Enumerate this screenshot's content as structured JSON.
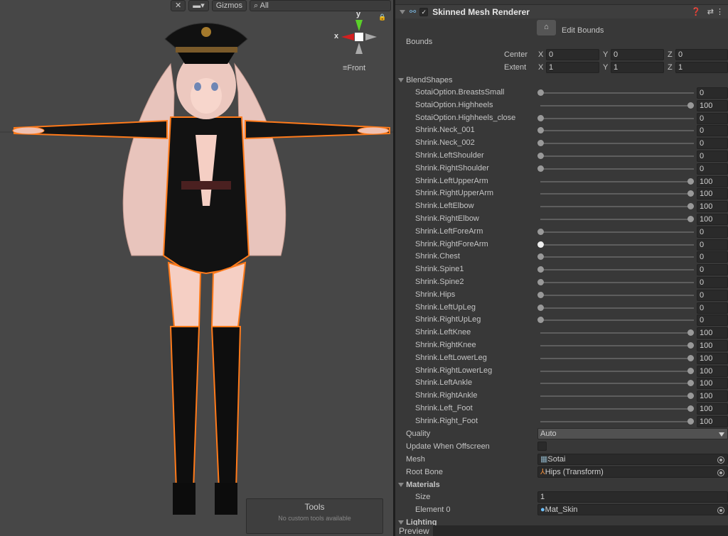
{
  "scene": {
    "toolbar": {
      "gizmos_label": "Gizmos",
      "search_placeholder": "All"
    },
    "gizmo": {
      "y_label": "y",
      "x_label": "x",
      "view_label": "Front"
    },
    "tools_panel": {
      "title": "Tools",
      "message": "No custom tools available"
    },
    "colors": {
      "outline": "#ff7a1a",
      "background": "#474747"
    }
  },
  "inspector": {
    "component_title": "Skinned Mesh Renderer",
    "enabled": true,
    "edit_bounds_label": "Edit Bounds",
    "bounds": {
      "label": "Bounds",
      "center": {
        "label": "Center",
        "x": "0",
        "y": "0",
        "z": "0"
      },
      "extent": {
        "label": "Extent",
        "x": "1",
        "y": "1",
        "z": "1"
      },
      "axis_x": "X",
      "axis_y": "Y",
      "axis_z": "Z"
    },
    "blendshapes_label": "BlendShapes",
    "blendshapes": [
      {
        "name": "SotaiOption.BreastsSmall",
        "value": 0
      },
      {
        "name": "SotaiOption.Highheels",
        "value": 100
      },
      {
        "name": "SotaiOption.Highheels_close",
        "value": 0
      },
      {
        "name": "Shrink.Neck_001",
        "value": 0
      },
      {
        "name": "Shrink.Neck_002",
        "value": 0
      },
      {
        "name": "Shrink.LeftShoulder",
        "value": 0
      },
      {
        "name": "Shrink.RightShoulder",
        "value": 0
      },
      {
        "name": "Shrink.LeftUpperArm",
        "value": 100
      },
      {
        "name": "Shrink.RightUpperArm",
        "value": 100
      },
      {
        "name": "Shrink.LeftElbow",
        "value": 100
      },
      {
        "name": "Shrink.RightElbow",
        "value": 100
      },
      {
        "name": "Shrink.LeftForeArm",
        "value": 0
      },
      {
        "name": "Shrink.RightForeArm",
        "value": 0
      },
      {
        "name": "Shrink.Chest",
        "value": 0
      },
      {
        "name": "Shrink.Spine1",
        "value": 0
      },
      {
        "name": "Shrink.Spine2",
        "value": 0
      },
      {
        "name": "Shrink.Hips",
        "value": 0
      },
      {
        "name": "Shrink.LeftUpLeg",
        "value": 0
      },
      {
        "name": "Shrink.RightUpLeg",
        "value": 0
      },
      {
        "name": "Shrink.LeftKnee",
        "value": 100
      },
      {
        "name": "Shrink.RightKnee",
        "value": 100
      },
      {
        "name": "Shrink.LeftLowerLeg",
        "value": 100
      },
      {
        "name": "Shrink.RightLowerLeg",
        "value": 100
      },
      {
        "name": "Shrink.LeftAnkle",
        "value": 100
      },
      {
        "name": "Shrink.RightAnkle",
        "value": 100
      },
      {
        "name": "Shrink.Left_Foot",
        "value": 100
      },
      {
        "name": "Shrink.Right_Foot",
        "value": 100
      }
    ],
    "quality": {
      "label": "Quality",
      "value": "Auto"
    },
    "update_offscreen": {
      "label": "Update When Offscreen",
      "checked": false
    },
    "mesh": {
      "label": "Mesh",
      "value": "Sotai"
    },
    "root_bone": {
      "label": "Root Bone",
      "value": "Hips (Transform)"
    },
    "materials": {
      "label": "Materials",
      "size_label": "Size",
      "size": "1",
      "element0_label": "Element 0",
      "element0": "Mat_Skin"
    },
    "lighting_label": "Lighting",
    "preview_label": "Preview"
  }
}
